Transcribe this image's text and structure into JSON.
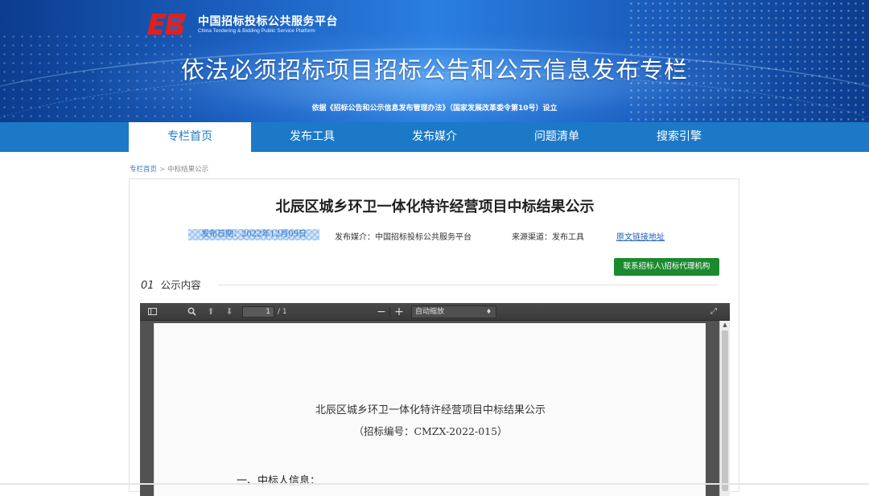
{
  "header": {
    "platform_name_cn": "中国招标投标公共服务平台",
    "platform_name_en": "China Tendering & Bidding Public Service Platform",
    "title": "依法必须招标项目招标公告和公示信息发布专栏",
    "subtitle": "依据《招标公告和公示信息发布管理办法》（国家发展改革委令第10号）设立"
  },
  "nav": {
    "items": [
      {
        "label": "专栏首页",
        "active": true
      },
      {
        "label": "发布工具"
      },
      {
        "label": "发布媒介"
      },
      {
        "label": "问题清单"
      },
      {
        "label": "搜索引擎"
      }
    ]
  },
  "breadcrumb": {
    "home": "专栏首页",
    "separator": ">",
    "current": "中标结果公示"
  },
  "notice": {
    "title": "北辰区城乡环卫一体化特许经营项目中标结果公示",
    "publish_date": "发布日期：2022年12月09日",
    "media": "发布媒介：中国招标投标公共服务平台",
    "source": "来源渠道：发布工具",
    "original_link": "原文链接地址",
    "contact_button": "联系招标人\\招标代理机构",
    "section_number": "01",
    "section_label": "公示内容"
  },
  "pdf_viewer": {
    "page_current": "1",
    "page_total": "/ 1",
    "zoom": "自动缩放",
    "icons": [
      "sidebar-toggle-icon",
      "search-icon",
      "arrow-up-icon",
      "arrow-down-icon",
      "zoom-out-icon",
      "zoom-in-icon",
      "fullscreen-icon"
    ],
    "page": {
      "title": "北辰区城乡环卫一体化特许经营项目中标结果公示",
      "code": "（招标编号：CMZX-2022-015）",
      "heading1": "一、中标人信息："
    }
  },
  "colors": {
    "nav_blue": "#1c79c8",
    "banner_dark": "#0b3c8e",
    "contact_green": "#1b8a2f",
    "logo_red": "#e02020"
  }
}
